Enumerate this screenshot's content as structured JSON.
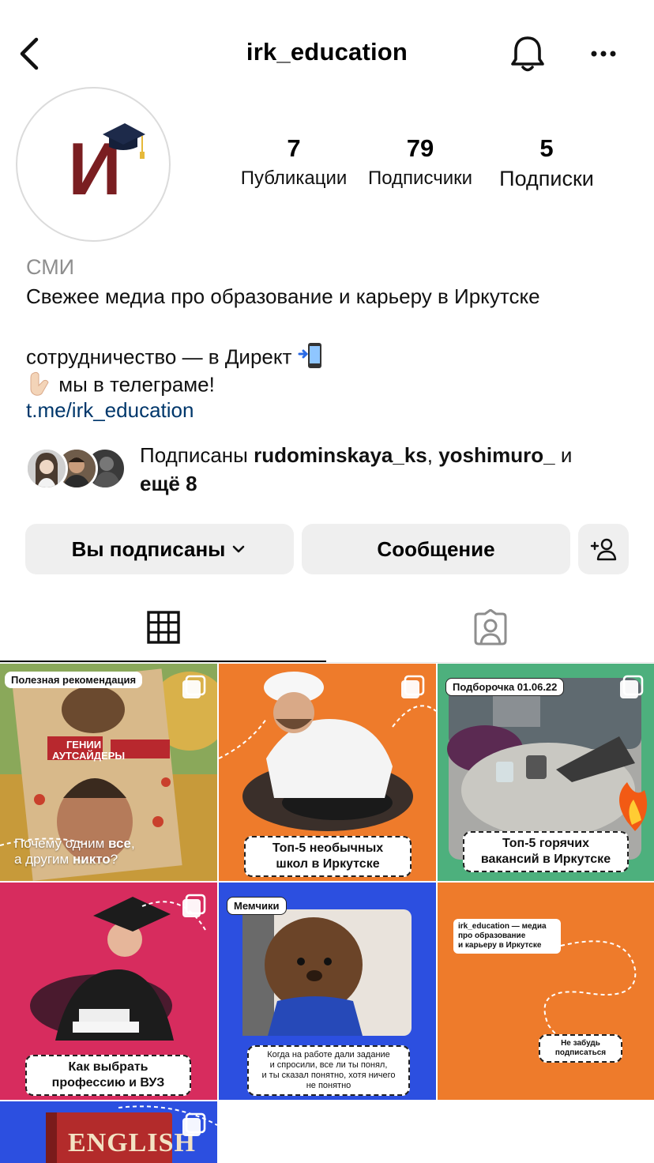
{
  "header": {
    "username": "irk_education",
    "icons": {
      "back": "chevron-left-icon",
      "notifications": "bell-icon",
      "more": "more-horizontal-icon"
    }
  },
  "avatar": {
    "logo_text": "И"
  },
  "stats": {
    "posts": {
      "value": "7",
      "label": "Публикации"
    },
    "followers": {
      "value": "79",
      "label": "Подписчики"
    },
    "following": {
      "value": "5",
      "label": "Подписки"
    }
  },
  "bio": {
    "category": "СМИ",
    "line1": "Свежее медиа про образование и карьеру в Иркутске",
    "line2": "сотрудничество — в Директ",
    "line2_emoji": "📲",
    "line3_emoji": "👇🏻",
    "line3": "мы в телеграме!",
    "link": "t.me/irk_education"
  },
  "followed_by": {
    "prefix": "Подписаны ",
    "user1": "rudominskaya_ks",
    "sep": ", ",
    "user2": "yoshimuro_",
    "and": " и",
    "more": "ещё 8"
  },
  "buttons": {
    "following": "Вы подписаны",
    "message": "Сообщение"
  },
  "tabs": {
    "grid_icon": "grid-icon",
    "tagged_icon": "tagged-person-icon"
  },
  "colors": {
    "link": "#00376b",
    "button_bg": "#efefef",
    "logo_red": "#7a1e21",
    "orange": "#ee7b2b",
    "green": "#4db07d",
    "magenta": "#d72c5e",
    "blue": "#2c4fe0"
  },
  "posts": [
    {
      "tag": "Полезная рекомендация",
      "caption_a": "Почему одним ",
      "caption_b": "все",
      "caption_c": ",",
      "caption_d": "а другим ",
      "caption_e": "никто",
      "caption_f": "?",
      "book_title": "ГЕНИИ АУТСАЙДЕРЫ"
    },
    {
      "caption1": "Топ-5 необычных",
      "caption2": "школ в Иркутске"
    },
    {
      "tag": "Подборочка 01.06.22",
      "caption1": "Топ-5 горячих",
      "caption2": "вакансий в Иркутске"
    },
    {
      "caption1": "Как выбрать",
      "caption2": "профессию и ВУЗ"
    },
    {
      "tag": "Мемчики",
      "caption1": "Когда на работе дали задание",
      "caption2": "и спросили, все ли ты понял,",
      "caption3": "и ты сказал понятно, хотя ничего",
      "caption4": "не понятно"
    },
    {
      "note1": "irk_education — медиа",
      "note2": "про образование",
      "note3": "и карьеру в Иркутске",
      "note4": "Не забудь",
      "note5": "подписаться"
    },
    {
      "book_title": "ENGLISH"
    }
  ]
}
